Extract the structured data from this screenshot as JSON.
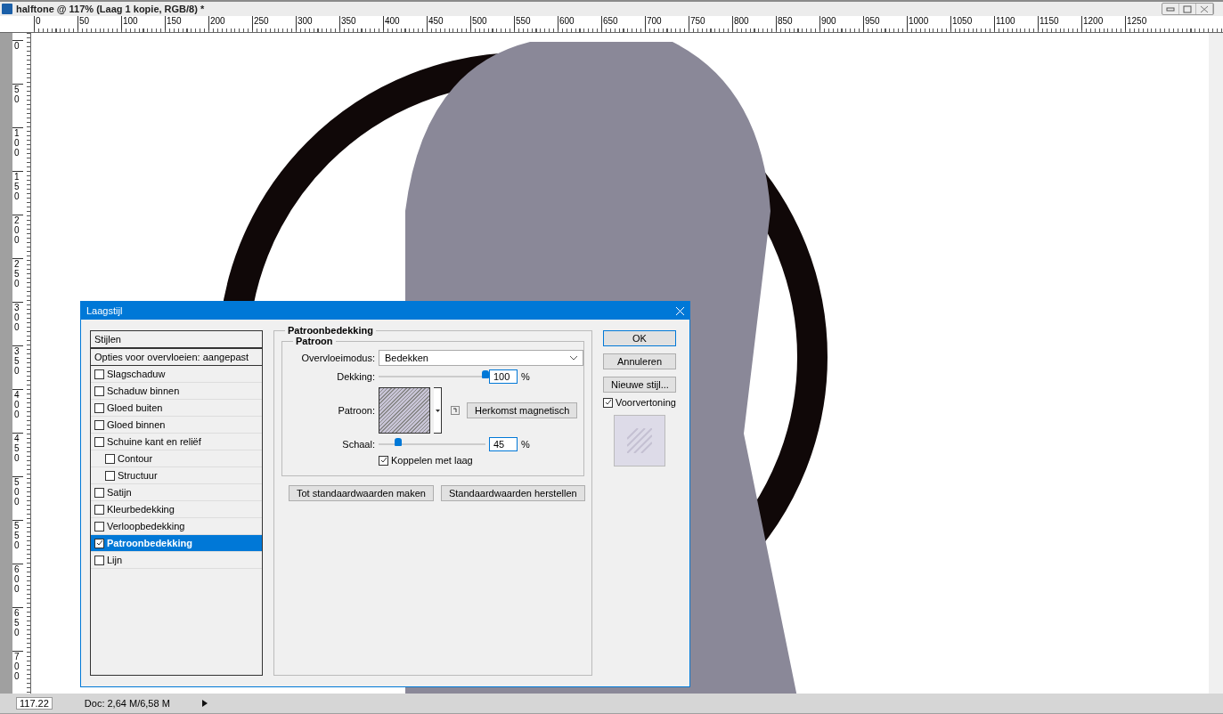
{
  "document_window": {
    "title": "halftone @ 117% (Laag 1 kopie, RGB/8) *"
  },
  "rulers": {
    "horizontal": [
      "0",
      "50",
      "100",
      "150",
      "200",
      "250",
      "300",
      "350",
      "400",
      "450",
      "500",
      "550",
      "600",
      "650",
      "700",
      "750",
      "800",
      "850",
      "900",
      "950",
      "1000",
      "1050",
      "1100",
      "1150",
      "1200",
      "1250"
    ],
    "vertical": [
      "0",
      "50",
      "100",
      "150",
      "200",
      "250",
      "300",
      "350",
      "400",
      "450",
      "500",
      "550",
      "600",
      "650",
      "700"
    ]
  },
  "dialog": {
    "title": "Laagstijl",
    "styles_header": "Stijlen",
    "blending_options": "Opties voor overvloeien: aangepast",
    "effects": [
      {
        "label": "Slagschaduw",
        "checked": false,
        "selected": false
      },
      {
        "label": "Schaduw binnen",
        "checked": false,
        "selected": false
      },
      {
        "label": "Gloed buiten",
        "checked": false,
        "selected": false
      },
      {
        "label": "Gloed binnen",
        "checked": false,
        "selected": false
      },
      {
        "label": "Schuine kant en reliëf",
        "checked": false,
        "selected": false,
        "children": [
          {
            "label": "Contour",
            "checked": false,
            "selected": false
          },
          {
            "label": "Structuur",
            "checked": false,
            "selected": false
          }
        ]
      },
      {
        "label": "Satijn",
        "checked": false,
        "selected": false
      },
      {
        "label": "Kleurbedekking",
        "checked": false,
        "selected": false
      },
      {
        "label": "Verloopbedekking",
        "checked": false,
        "selected": false
      },
      {
        "label": "Patroonbedekking",
        "checked": true,
        "selected": true
      },
      {
        "label": "Lijn",
        "checked": false,
        "selected": false
      }
    ],
    "section_title": "Patroonbedekking",
    "group_title": "Patroon",
    "blend_mode": {
      "label": "Overvloeimodus:",
      "value": "Bedekken"
    },
    "opacity": {
      "label": "Dekking:",
      "level": 1,
      "value": "100",
      "unit": "%"
    },
    "pattern": {
      "label": "Patroon:",
      "button": "Herkomst magnetisch"
    },
    "scale": {
      "label": "Schaal:",
      "level": 0.18,
      "value": "45",
      "unit": "%"
    },
    "link_with_layer": {
      "label": "Koppelen met laag",
      "checked": true
    },
    "buttons_bottom": [
      "Tot standaardwaarden maken",
      "Standaardwaarden herstellen"
    ],
    "buttons_side": [
      {
        "label": "OK",
        "default": true
      },
      {
        "label": "Annuleren",
        "default": false
      },
      {
        "label": "Nieuwe stijl...",
        "default": false
      }
    ],
    "preview": {
      "label": "Voorvertoning",
      "checked": true
    }
  },
  "status_bar": {
    "zoom": "117.22",
    "doc": "Doc: 2,64 M/6,58 M"
  }
}
